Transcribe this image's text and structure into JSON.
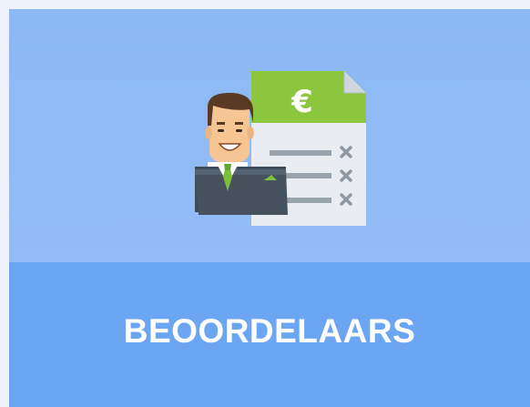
{
  "tile": {
    "label": "BEOORDELAARS",
    "icon": "assessor-with-invoice-icon",
    "currency_symbol": "€",
    "colors": {
      "top_background": "#8fbaf6",
      "bottom_background": "#6ca6f3",
      "label_text": "#ffffff",
      "document_header": "#8cc63f",
      "document_body": "#e8ecf1",
      "suit": "#3d4a57",
      "tie": "#7dbf3a"
    }
  }
}
